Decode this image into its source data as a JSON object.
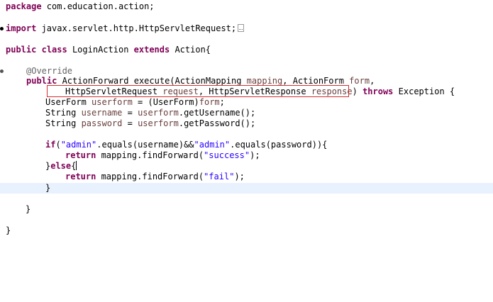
{
  "code": {
    "package_kw": "package",
    "package_name": " com.education.action;",
    "import_kw": "import",
    "import_name": " javax.servlet.http.HttpServletRequest;",
    "class_kw1": "public",
    "class_kw2": "class",
    "class_name": " LoginAction ",
    "extends_kw": "extends",
    "class_rest": " Action{",
    "annotation": "@Override",
    "method_kw": "public",
    "method_sig_a": " ActionForward execute(ActionMapping ",
    "param_mapping": "mapping",
    "method_sig_b": ", ActionForm ",
    "param_form": "form",
    "method_sig_c": ",",
    "sig2_a": "HttpServletRequest ",
    "param_request": "request",
    "sig2_b": ", HttpServletResponse ",
    "param_response": "response",
    "sig2_c": ") ",
    "throws_kw": "throws",
    "sig2_d": " Exception {",
    "l1_a": "UserForm ",
    "l1_var": "userform",
    "l1_b": " = (UserForm)",
    "l1_form": "form",
    "l1_c": ";",
    "l2_a": "String ",
    "l2_var": "username",
    "l2_b": " = ",
    "l2_uf": "userform",
    "l2_c": ".getUsername();",
    "l3_a": "String ",
    "l3_var": "password",
    "l3_b": " = ",
    "l3_uf": "userform",
    "l3_c": ".getPassword();",
    "if_kw": "if",
    "if_a": "(",
    "if_str1": "\"admin\"",
    "if_b": ".equals(",
    "if_v1": "username",
    "if_c": ")&&",
    "if_str2": "\"admin\"",
    "if_d": ".equals(",
    "if_v2": "password",
    "if_e": ")){",
    "ret_kw1": "return",
    "ret1_a": " mapping.findForward(",
    "ret1_str": "\"success\"",
    "ret1_b": ");",
    "else_a": "}",
    "else_kw": "else",
    "else_b": "{",
    "ret_kw2": "return",
    "ret2_a": " mapping.findForward(",
    "ret2_str": "\"fail\"",
    "ret2_b": ");",
    "close_if": "}",
    "close_method": "}",
    "close_class": "}"
  },
  "colors": {
    "keyword": "#7f0055",
    "string": "#2a00ff",
    "annotation": "#646464",
    "variable": "#6a3e3e",
    "current_line": "#e8f2fe",
    "highlight_box": "#d32f2f"
  }
}
